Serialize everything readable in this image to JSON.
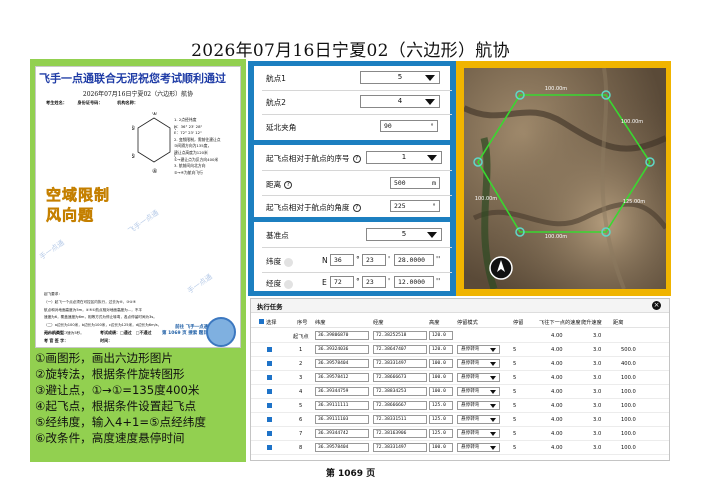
{
  "title": "2026年07月16日宁夏02（六边形）航协",
  "document": {
    "banner": "飞手一点通联合无泥祝您考试顺利通过",
    "subtitle": "2026年07月16日宁夏02（六边形）航协",
    "candidate_line": "考生姓名：　　　身份证号码：　　　　机构名称：",
    "hex_labels": [
      "①",
      "②",
      "③",
      "④",
      "⑤",
      "⑥"
    ],
    "conditions": "1. 2点经纬度\nN：36° 23' 28\"\nE：72° 23' 12\"\n2. 变频限制，需前往建让点\n③间隔方向为135度，\n建让点高度为120米\n①→建让点为反方向400米\n3. 航前间向北方向\n⑤→④为航向飞行",
    "watermark_lines": [
      "空域限制",
      "风向题"
    ],
    "side_marks": [
      "手一点通",
      "手一点通",
      "飞手一点通"
    ],
    "exam_text": "起飞要求：\n（一）起飞一个点必须在可控区内执行，过去为⑥、③④⑤\n航点和对地面高度为5m，④⑤①航点相对地面高度为...，不平\n速度为6，覆盖速度为6m，相等方式为停止转弯，各点停留时间为3s。\n（二）a边长为100米，b边长为100米，c边长为125米，d边长为6m/s，\ne速为5m/s，f速为5秒。",
    "signatures": [
      "无人机类型：　　　　　　　　考试成绩：□通过　□不通过",
      "考 官 签 字：　　　　　　　　时间："
    ],
    "promo": [
      "前往 飞手一点通",
      "第 1069 页 搜索 题目看答案"
    ]
  },
  "steps": [
    "①画图形，画出六边形图片",
    "②旋转法，根据条件旋转图形",
    "③避让点，①→①=135度400米",
    "④起飞点，根据条件设置起飞点",
    "⑤经纬度，输入4+1=⑤点经纬度",
    "⑥改条件，高度速度悬停时间"
  ],
  "settings": {
    "box1": {
      "nav1_label": "航点1",
      "nav1_value": "5",
      "nav2_label": "航点2",
      "nav2_value": "4",
      "angle_label": "延北夹角",
      "angle_value": "90",
      "angle_unit": "°"
    },
    "box2": {
      "takeoff_index_label": "起飞点相对于航点的序号",
      "takeoff_index_value": "1",
      "distance_label": "距离",
      "distance_value": "500",
      "distance_unit": "m",
      "takeoff_angle_label": "起飞点相对于航点的角度",
      "takeoff_angle_value": "225",
      "takeoff_angle_unit": "°"
    },
    "box3": {
      "base_label": "基准点",
      "base_value": "5",
      "lat_label": "纬度",
      "lat_hemi": "N",
      "lat_deg": "36",
      "lat_min": "23",
      "lat_sec": "28.0000",
      "lon_label": "经度",
      "lon_hemi": "E",
      "lon_deg": "72",
      "lon_min": "23",
      "lon_sec": "12.0000",
      "deg_sym": "°",
      "min_sym": "'",
      "sec_sym": "''"
    }
  },
  "map": {
    "labels": [
      "100.00m",
      "100.00m",
      "125.00m",
      "100.00m",
      "100.00m"
    ],
    "route_color": "#39d830",
    "point_color": "#5fd8c8"
  },
  "task": {
    "title": "执行任务",
    "headers": [
      "选择",
      "序号",
      "纬度",
      "经度",
      "高度",
      "停留模式",
      "停留",
      "飞往下一点的速度",
      "爬升速度",
      "距离"
    ],
    "rows": [
      {
        "seq": "起飞点",
        "lat": "36.39806870",
        "lon": "72.38252518",
        "alt": "120.0",
        "mode": "",
        "wait": "",
        "speed": "4.00",
        "climb": "3.0",
        "dist": "",
        "checked": false
      },
      {
        "seq": "1",
        "lat": "36.39324036",
        "lon": "72.38647407",
        "alt": "120.0",
        "mode": "悬停转弯",
        "wait": "5",
        "speed": "4.00",
        "climb": "3.0",
        "dist": "500.0",
        "checked": true
      },
      {
        "seq": "2",
        "lat": "36.39578404",
        "lon": "72.38331497",
        "alt": "100.0",
        "mode": "悬停转弯",
        "wait": "5",
        "speed": "4.00",
        "climb": "3.0",
        "dist": "400.0",
        "checked": true
      },
      {
        "seq": "3",
        "lat": "36.39578412",
        "lon": "72.38666673",
        "alt": "100.0",
        "mode": "悬停转弯",
        "wait": "5",
        "speed": "4.00",
        "climb": "3.0",
        "dist": "100.0",
        "checked": true
      },
      {
        "seq": "4",
        "lat": "36.39344759",
        "lon": "72.38834253",
        "alt": "100.0",
        "mode": "悬停转弯",
        "wait": "5",
        "speed": "4.00",
        "climb": "3.0",
        "dist": "100.0",
        "checked": true
      },
      {
        "seq": "5",
        "lat": "36.39111111",
        "lon": "72.38666667",
        "alt": "125.0",
        "mode": "悬停转弯",
        "wait": "5",
        "speed": "4.00",
        "climb": "3.0",
        "dist": "100.0",
        "checked": true
      },
      {
        "seq": "6",
        "lat": "36.39111103",
        "lon": "72.38331511",
        "alt": "125.0",
        "mode": "悬停转弯",
        "wait": "5",
        "speed": "4.00",
        "climb": "3.0",
        "dist": "100.0",
        "checked": true
      },
      {
        "seq": "7",
        "lat": "36.39344742",
        "lon": "72.38163906",
        "alt": "125.0",
        "mode": "悬停转弯",
        "wait": "5",
        "speed": "4.00",
        "climb": "3.0",
        "dist": "100.0",
        "checked": true
      },
      {
        "seq": "8",
        "lat": "36.39578404",
        "lon": "72.38331497",
        "alt": "100.0",
        "mode": "悬停转弯",
        "wait": "5",
        "speed": "4.00",
        "climb": "3.0",
        "dist": "100.0",
        "checked": true
      }
    ]
  },
  "page_label": "第 1069 页"
}
